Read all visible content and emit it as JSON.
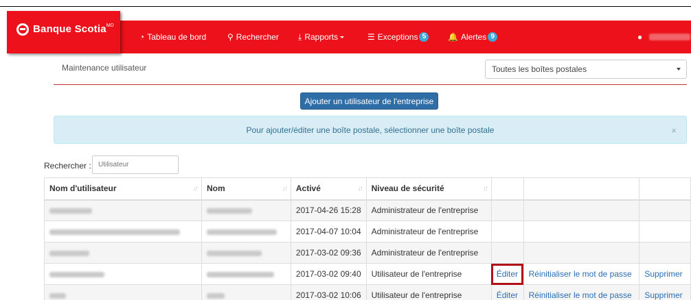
{
  "navbar": {
    "logo": "Banque Scotia",
    "logo_tm": "MD",
    "items": [
      {
        "label": "Tableau de bord",
        "icon": "dashboard-icon"
      },
      {
        "label": "Rechercher",
        "icon": "search-icon"
      },
      {
        "label": "Rapports",
        "icon": "download-icon"
      },
      {
        "label": "Exceptions",
        "icon": "list-icon",
        "badge": "5"
      },
      {
        "label": "Alertes",
        "icon": "bell-icon",
        "badge": "9"
      }
    ],
    "user_icon": "user-icon",
    "accent": "#ec111a"
  },
  "page": {
    "title": "Maintenance utilisateur",
    "mailbox_select": "Toutes les boîtes postales",
    "add_button": "Ajouter un utilisateur de l'entreprise",
    "alert": "Pour ajouter/éditer une boîte postale, sélectionner une boîte postale",
    "alert_close": "×",
    "search_label": "Rechercher :",
    "search_placeholder": "Utilisateur"
  },
  "table": {
    "headers": [
      "Nom d'utilisateur",
      "Nom",
      "Activé",
      "Niveau de sécurité",
      "",
      "",
      ""
    ],
    "rows": [
      {
        "activated": "2017-04-26 15:28",
        "level": "Administrateur de l'entreprise",
        "edit": "",
        "reset": "",
        "delete": ""
      },
      {
        "activated": "2017-04-07 10:04",
        "level": "Administrateur de l'entreprise",
        "edit": "",
        "reset": "",
        "delete": ""
      },
      {
        "activated": "2017-03-02 09:36",
        "level": "Administrateur de l'entreprise",
        "edit": "",
        "reset": "",
        "delete": ""
      },
      {
        "activated": "2017-03-02 09:40",
        "level": "Utilisateur de l'entreprise",
        "edit": "Éditer",
        "reset": "Réinitialiser le mot de passe",
        "delete": "Supprimer"
      },
      {
        "activated": "2017-03-02 10:06",
        "level": "Utilisateur de l'entreprise",
        "edit": "Éditer",
        "reset": "Réinitialiser le mot de passe",
        "delete": "Supprimer"
      }
    ]
  }
}
